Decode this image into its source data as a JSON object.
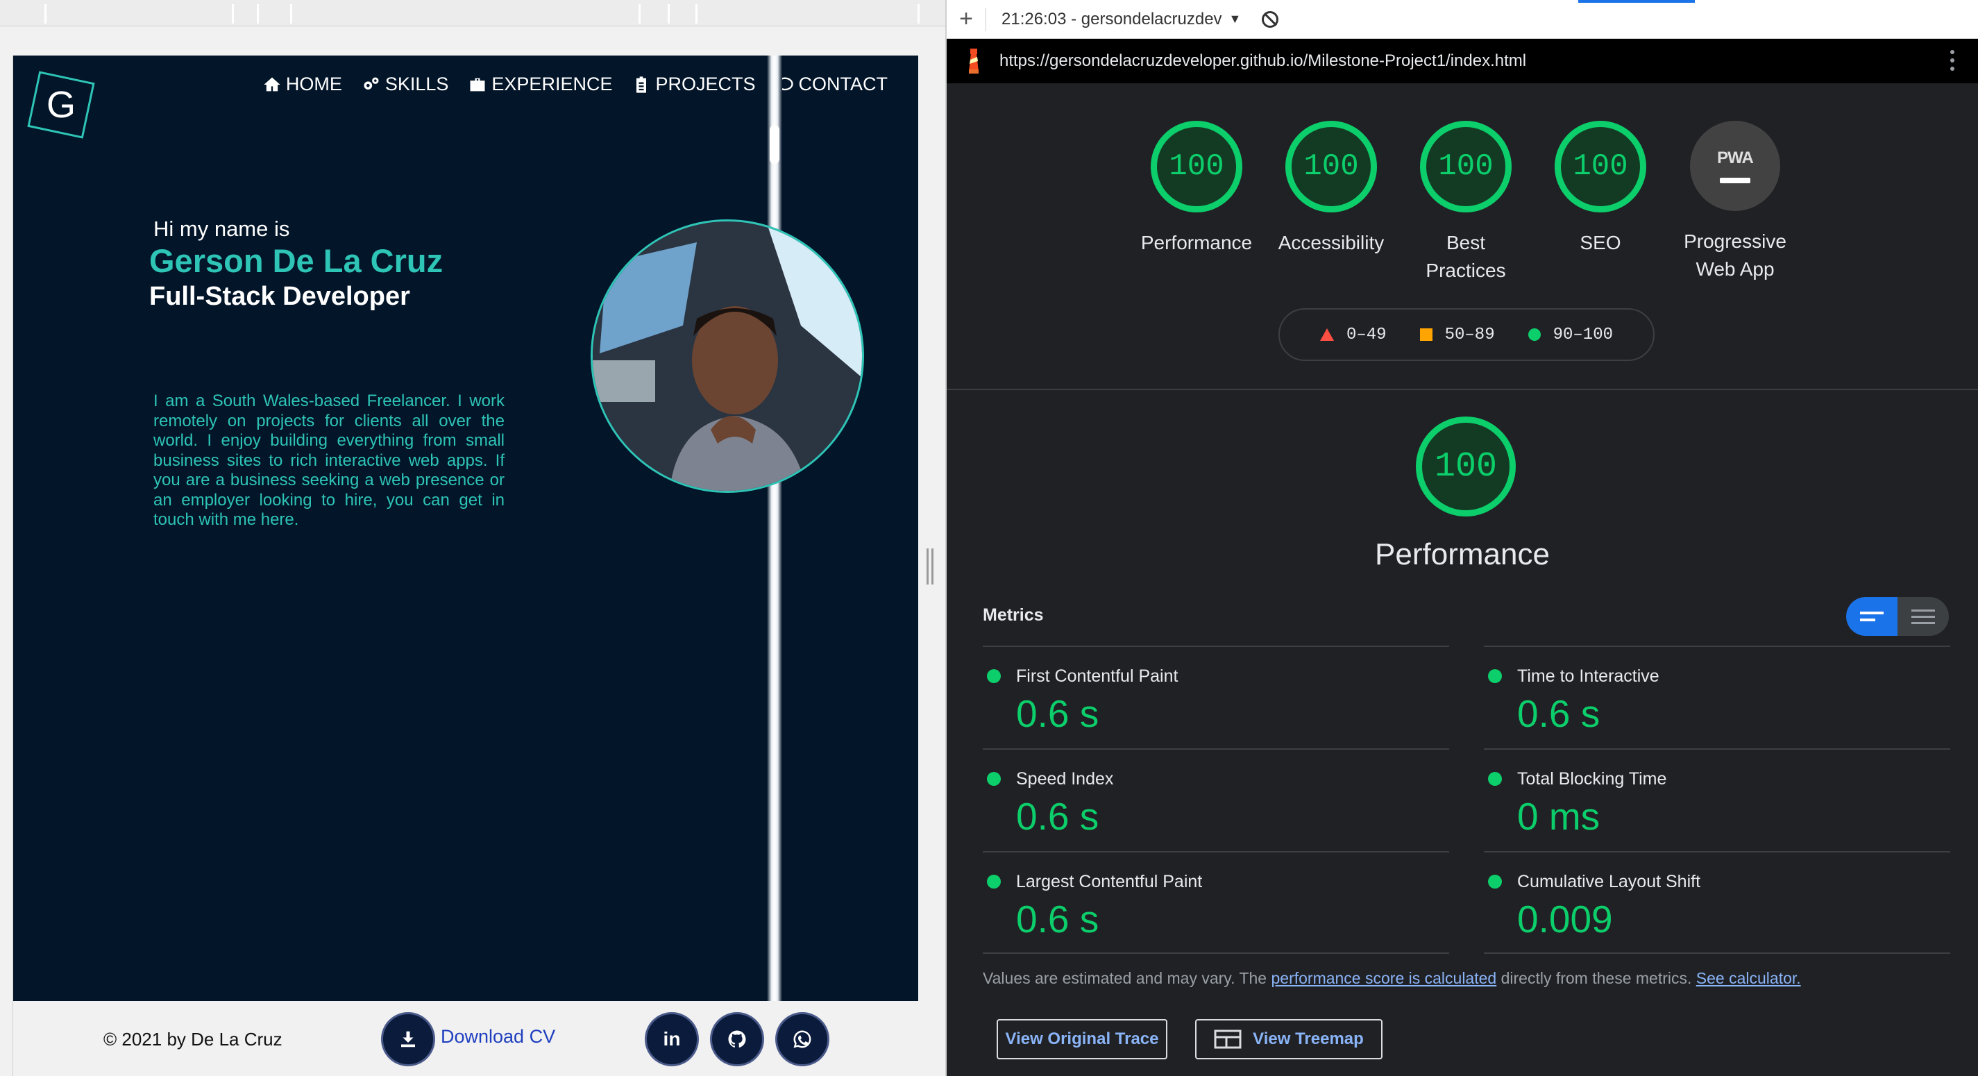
{
  "preview": {
    "logo_letter": "G",
    "nav": [
      {
        "label": "HOME",
        "icon": "home-icon"
      },
      {
        "label": "SKILLS",
        "icon": "gears-icon"
      },
      {
        "label": "EXPERIENCE",
        "icon": "briefcase-icon"
      },
      {
        "label": "PROJECTS",
        "icon": "clipboard-icon"
      },
      {
        "label": "CONTACT",
        "icon": "chat-bubble-icon"
      }
    ],
    "greeting": "Hi my name is",
    "name": "Gerson De La Cruz",
    "role": "Full-Stack Developer",
    "bio": "I am a South Wales-based Freelancer. I work remotely on projects for clients all over the world. I enjoy building everything from small business sites to rich interactive web apps. If you are a business seeking a web presence or an employer looking to hire, you can get in touch with me here.",
    "footer": {
      "copyright": "© 2021 by De La Cruz",
      "download_label": "Download CV",
      "social": [
        {
          "icon": "linkedin-icon",
          "text": "in"
        },
        {
          "icon": "github-icon",
          "text": ""
        },
        {
          "icon": "whatsapp-icon",
          "text": ""
        }
      ]
    },
    "colors": {
      "hero_bg": "#031529",
      "accent": "#2ec4b6"
    }
  },
  "devtools": {
    "report_time": "21:26:03 - gersondelacruzdev",
    "url": "https://gersondelacruzdeveloper.github.io/Milestone-Project1/index.html",
    "gauges": [
      {
        "score": "100",
        "label": "Performance"
      },
      {
        "score": "100",
        "label": "Accessibility"
      },
      {
        "score": "100",
        "label": "Best Practices"
      },
      {
        "score": "100",
        "label": "SEO"
      }
    ],
    "pwa": {
      "badge": "PWA",
      "label": "Progressive Web App"
    },
    "legend": [
      {
        "range": "0–49",
        "color": "#ff4e42"
      },
      {
        "range": "50–89",
        "color": "#ffa400"
      },
      {
        "range": "90–100",
        "color": "#0cce6b"
      }
    ],
    "performance": {
      "score": "100",
      "title": "Performance"
    },
    "metrics_label": "Metrics",
    "metrics_left": [
      {
        "title": "First Contentful Paint",
        "value": "0.6 s"
      },
      {
        "title": "Speed Index",
        "value": "0.6 s"
      },
      {
        "title": "Largest Contentful Paint",
        "value": "0.6 s"
      }
    ],
    "metrics_right": [
      {
        "title": "Time to Interactive",
        "value": "0.6 s"
      },
      {
        "title": "Total Blocking Time",
        "value": "0 ms"
      },
      {
        "title": "Cumulative Layout Shift",
        "value": "0.009"
      }
    ],
    "note": {
      "prefix": "Values are estimated and may vary. The ",
      "link1": "performance score is calculated",
      "middle": " directly from these metrics. ",
      "link2": "See calculator."
    },
    "buttons": {
      "trace": "View Original Trace",
      "treemap": "View Treemap"
    },
    "colors": {
      "pass": "#0cce6b",
      "average": "#ffa400",
      "fail": "#ff4e42",
      "panel_bg": "#202124"
    }
  }
}
